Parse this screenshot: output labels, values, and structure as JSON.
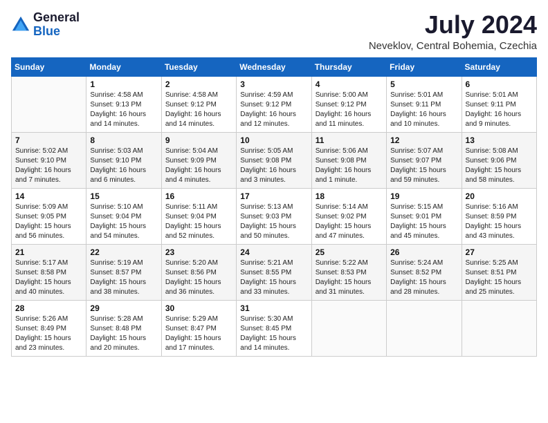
{
  "logo": {
    "text_general": "General",
    "text_blue": "Blue"
  },
  "title": {
    "month_year": "July 2024",
    "location": "Neveklov, Central Bohemia, Czechia"
  },
  "weekdays": [
    "Sunday",
    "Monday",
    "Tuesday",
    "Wednesday",
    "Thursday",
    "Friday",
    "Saturday"
  ],
  "weeks": [
    [
      {
        "day": "",
        "info": ""
      },
      {
        "day": "1",
        "info": "Sunrise: 4:58 AM\nSunset: 9:13 PM\nDaylight: 16 hours\nand 14 minutes."
      },
      {
        "day": "2",
        "info": "Sunrise: 4:58 AM\nSunset: 9:12 PM\nDaylight: 16 hours\nand 14 minutes."
      },
      {
        "day": "3",
        "info": "Sunrise: 4:59 AM\nSunset: 9:12 PM\nDaylight: 16 hours\nand 12 minutes."
      },
      {
        "day": "4",
        "info": "Sunrise: 5:00 AM\nSunset: 9:12 PM\nDaylight: 16 hours\nand 11 minutes."
      },
      {
        "day": "5",
        "info": "Sunrise: 5:01 AM\nSunset: 9:11 PM\nDaylight: 16 hours\nand 10 minutes."
      },
      {
        "day": "6",
        "info": "Sunrise: 5:01 AM\nSunset: 9:11 PM\nDaylight: 16 hours\nand 9 minutes."
      }
    ],
    [
      {
        "day": "7",
        "info": "Sunrise: 5:02 AM\nSunset: 9:10 PM\nDaylight: 16 hours\nand 7 minutes."
      },
      {
        "day": "8",
        "info": "Sunrise: 5:03 AM\nSunset: 9:10 PM\nDaylight: 16 hours\nand 6 minutes."
      },
      {
        "day": "9",
        "info": "Sunrise: 5:04 AM\nSunset: 9:09 PM\nDaylight: 16 hours\nand 4 minutes."
      },
      {
        "day": "10",
        "info": "Sunrise: 5:05 AM\nSunset: 9:08 PM\nDaylight: 16 hours\nand 3 minutes."
      },
      {
        "day": "11",
        "info": "Sunrise: 5:06 AM\nSunset: 9:08 PM\nDaylight: 16 hours\nand 1 minute."
      },
      {
        "day": "12",
        "info": "Sunrise: 5:07 AM\nSunset: 9:07 PM\nDaylight: 15 hours\nand 59 minutes."
      },
      {
        "day": "13",
        "info": "Sunrise: 5:08 AM\nSunset: 9:06 PM\nDaylight: 15 hours\nand 58 minutes."
      }
    ],
    [
      {
        "day": "14",
        "info": "Sunrise: 5:09 AM\nSunset: 9:05 PM\nDaylight: 15 hours\nand 56 minutes."
      },
      {
        "day": "15",
        "info": "Sunrise: 5:10 AM\nSunset: 9:04 PM\nDaylight: 15 hours\nand 54 minutes."
      },
      {
        "day": "16",
        "info": "Sunrise: 5:11 AM\nSunset: 9:04 PM\nDaylight: 15 hours\nand 52 minutes."
      },
      {
        "day": "17",
        "info": "Sunrise: 5:13 AM\nSunset: 9:03 PM\nDaylight: 15 hours\nand 50 minutes."
      },
      {
        "day": "18",
        "info": "Sunrise: 5:14 AM\nSunset: 9:02 PM\nDaylight: 15 hours\nand 47 minutes."
      },
      {
        "day": "19",
        "info": "Sunrise: 5:15 AM\nSunset: 9:01 PM\nDaylight: 15 hours\nand 45 minutes."
      },
      {
        "day": "20",
        "info": "Sunrise: 5:16 AM\nSunset: 8:59 PM\nDaylight: 15 hours\nand 43 minutes."
      }
    ],
    [
      {
        "day": "21",
        "info": "Sunrise: 5:17 AM\nSunset: 8:58 PM\nDaylight: 15 hours\nand 40 minutes."
      },
      {
        "day": "22",
        "info": "Sunrise: 5:19 AM\nSunset: 8:57 PM\nDaylight: 15 hours\nand 38 minutes."
      },
      {
        "day": "23",
        "info": "Sunrise: 5:20 AM\nSunset: 8:56 PM\nDaylight: 15 hours\nand 36 minutes."
      },
      {
        "day": "24",
        "info": "Sunrise: 5:21 AM\nSunset: 8:55 PM\nDaylight: 15 hours\nand 33 minutes."
      },
      {
        "day": "25",
        "info": "Sunrise: 5:22 AM\nSunset: 8:53 PM\nDaylight: 15 hours\nand 31 minutes."
      },
      {
        "day": "26",
        "info": "Sunrise: 5:24 AM\nSunset: 8:52 PM\nDaylight: 15 hours\nand 28 minutes."
      },
      {
        "day": "27",
        "info": "Sunrise: 5:25 AM\nSunset: 8:51 PM\nDaylight: 15 hours\nand 25 minutes."
      }
    ],
    [
      {
        "day": "28",
        "info": "Sunrise: 5:26 AM\nSunset: 8:49 PM\nDaylight: 15 hours\nand 23 minutes."
      },
      {
        "day": "29",
        "info": "Sunrise: 5:28 AM\nSunset: 8:48 PM\nDaylight: 15 hours\nand 20 minutes."
      },
      {
        "day": "30",
        "info": "Sunrise: 5:29 AM\nSunset: 8:47 PM\nDaylight: 15 hours\nand 17 minutes."
      },
      {
        "day": "31",
        "info": "Sunrise: 5:30 AM\nSunset: 8:45 PM\nDaylight: 15 hours\nand 14 minutes."
      },
      {
        "day": "",
        "info": ""
      },
      {
        "day": "",
        "info": ""
      },
      {
        "day": "",
        "info": ""
      }
    ]
  ]
}
